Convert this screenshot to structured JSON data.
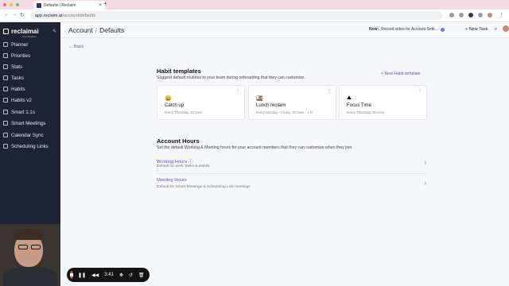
{
  "browser": {
    "tab_title": "Defaults | Reclaim",
    "tab_close": "×",
    "new_tab": "+",
    "url_host": "app.reclaim.ai",
    "url_path": "/account/defaults"
  },
  "sidebar": {
    "logo": "reclaimai",
    "logo_sub": "from Dropbox",
    "items": [
      {
        "label": "Planner",
        "icon": "calendar-icon"
      },
      {
        "label": "Priorities",
        "icon": "priorities-icon"
      },
      {
        "label": "Stats",
        "icon": "stats-icon"
      },
      {
        "label": "Tasks",
        "icon": "tasks-icon"
      },
      {
        "label": "Habits",
        "icon": "habits-icon"
      },
      {
        "label": "Habits v2",
        "icon": "habits-icon"
      },
      {
        "label": "Smart 1:1s",
        "icon": "people-icon"
      },
      {
        "label": "Smart Meetings",
        "icon": "meetings-icon"
      },
      {
        "label": "Calendar Sync",
        "icon": "sync-icon"
      },
      {
        "label": "Scheduling Links",
        "icon": "link-icon"
      }
    ]
  },
  "header": {
    "crumb_parent": "Account",
    "crumb_sep": "/",
    "crumb_current": "Defaults",
    "now_label": "Now:",
    "now_text": "Record video for Account Setti...",
    "new_task": "+ New Task"
  },
  "back": "← Back",
  "habits": {
    "title": "Habit templates",
    "subtitle": "Suggest default routines to your team during onboarding that they can customize.",
    "new_button": "+ New Habit template",
    "cards": [
      {
        "emoji": "😄",
        "title": "Catch up",
        "sub": "Every Thursday, 30 mins"
      },
      {
        "emoji": "🍱",
        "title": "Lunch reclaim",
        "sub": "Every Monday - Friday, 30 mins - 1 hr"
      },
      {
        "emoji": "⛰",
        "title": "Focus Time",
        "sub": "Every Thursday, 30 mins"
      }
    ]
  },
  "account_hours": {
    "title": "Account Hours",
    "subtitle": "Set the default Working & Meeting hours for your account members that they can customize when they join.",
    "rows": [
      {
        "title": "Working Hours ⓘ",
        "desc": "Default for work Tasks & Habits"
      },
      {
        "title": "Meeting Hours",
        "desc": "Default for Smart Meetings & Scheduling Link meetings"
      }
    ]
  },
  "recorder": {
    "time": "3:41"
  }
}
